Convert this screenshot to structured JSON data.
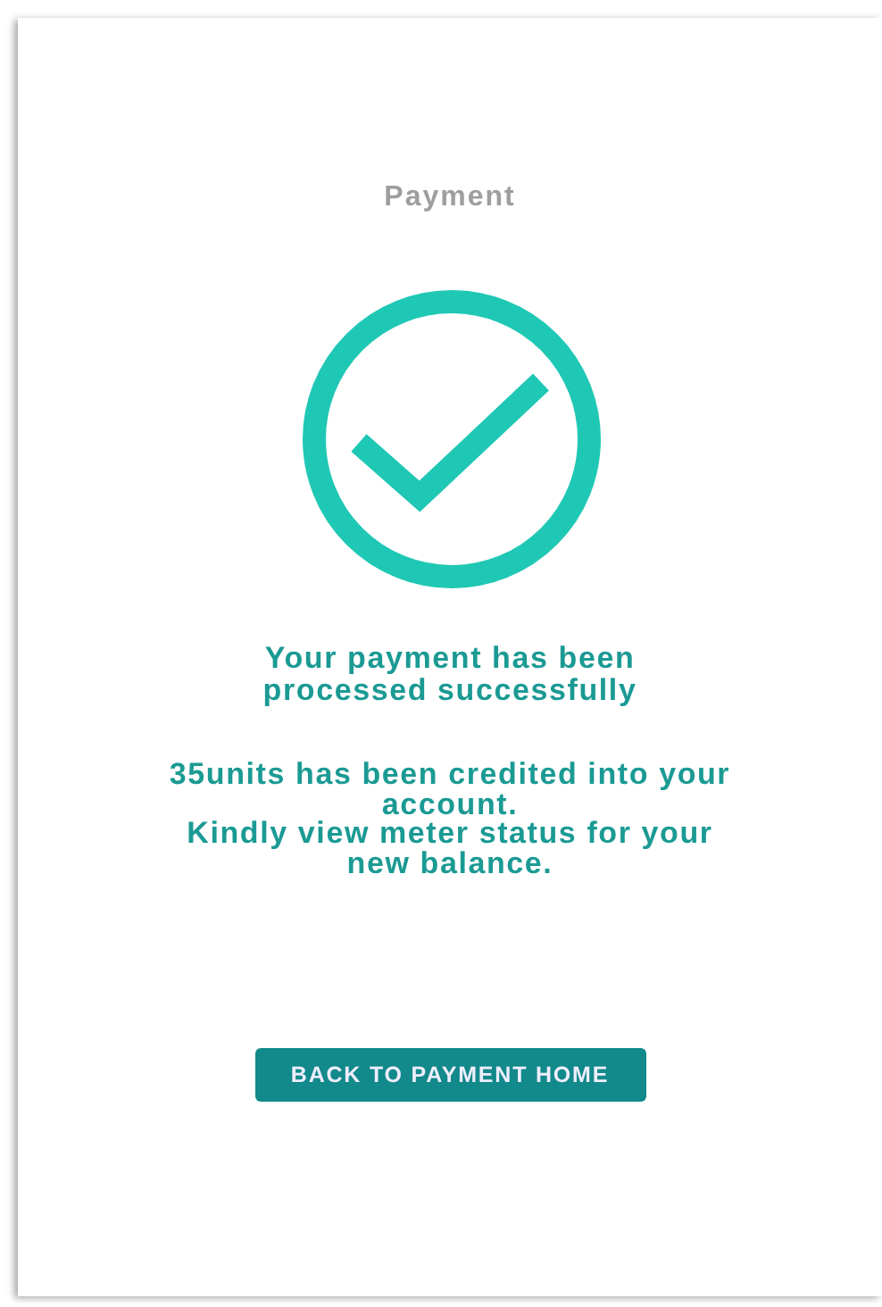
{
  "title": "Payment",
  "status": {
    "kind": "success",
    "message": "Your payment has been processed successfully"
  },
  "details": [
    "35units has been credited into your account.",
    "Kindly view meter status for your new balance."
  ],
  "button": "BACK TO PAYMENT HOME"
}
